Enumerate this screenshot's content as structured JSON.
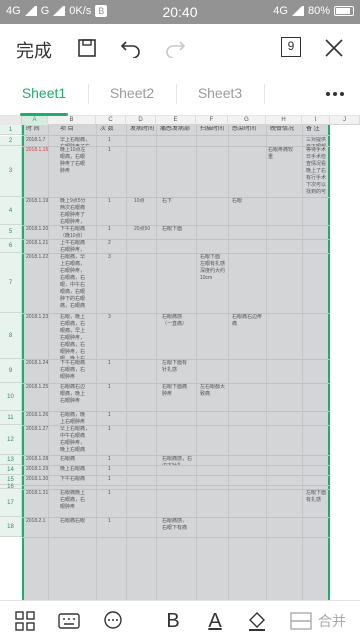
{
  "status": {
    "carrier1": "4G",
    "carrier2": "G",
    "speed": "0K/s",
    "b_badge": "B",
    "time": "20:40",
    "net": "4G",
    "battery": "80%"
  },
  "toolbar": {
    "done_label": "完成",
    "sheet_count": "9"
  },
  "tabs": [
    {
      "label": "Sheet1"
    },
    {
      "label": "Sheet2"
    },
    {
      "label": "Sheet3"
    }
  ],
  "columns": [
    "A",
    "B",
    "C",
    "D",
    "E",
    "F",
    "G",
    "H",
    "I",
    "J"
  ],
  "header_row": [
    "时 间",
    "项 目",
    "次 数",
    "发病时间",
    "痛感发病部",
    "扫描时间",
    "感染时间",
    "晚餐情况",
    "备 注"
  ],
  "rows": [
    {
      "num": "2",
      "date": "2018.1.7",
      "item": "早上右眼痛，\n右眼肿疼了右",
      "count": "1",
      "e": "",
      "f": "",
      "g": "",
      "h": "",
      "i": "",
      "j": "三对提供\n日下眼部\n疾病，\n医药公安"
    },
    {
      "num": "3",
      "date": "2018.1.15",
      "item": "晚上10点左\n眼痛，右眼\n肿疼了右眼\n肿疼",
      "count": "1",
      "e": "",
      "f": "",
      "g": "",
      "h": "",
      "i": "右眼疼痛较\n重",
      "j": "等待手术\n日手术检\n查情况看\n晚上了右\n有行手术\n下次可以\n找到的可"
    },
    {
      "num": "4",
      "date": "2018.1.19",
      "item": "晚上9点5分\n两次右眼痛\n右眼肿疼了\n右眼肿疼，\n右边晚间下",
      "count": "1",
      "e": "10点",
      "f": "右下",
      "g": "",
      "h": "右眼",
      "i": "",
      "j": ""
    },
    {
      "num": "5",
      "date": "2018.1.20",
      "item": "下午右眼痛\n（晚10点）",
      "count": "1",
      "e": "20点50",
      "f": "右眼下面",
      "g": "",
      "h": "",
      "i": "",
      "j": ""
    },
    {
      "num": "6",
      "date": "2018.1.21",
      "item": "上午右眼痛\n右眼肿疼，\n右眼肿疼",
      "count": "2",
      "e": "",
      "f": "",
      "g": "",
      "h": "",
      "i": "",
      "j": ""
    },
    {
      "num": "7",
      "date": "2018.1.22",
      "item": "右眼痛，早\n上右眼痛，\n右眼肿疼，\n右眼痛，右\n眼，中午右\n眼痛，右眼\n肿下的右眼\n痛，右眼痛",
      "count": "3",
      "e": "",
      "f": "",
      "g": "右眼下面\n左眼有扎感\n深度约大约\n10cm",
      "h": "",
      "i": "",
      "j": ""
    },
    {
      "num": "8",
      "date": "2018.1.23",
      "item": "右眼，晚上\n右眼痛，右\n眼痛，早上\n右眼肿疼，\n右眼痛，右\n眼肿疼，右\n眼，晚上右\n眼痛",
      "count": "3",
      "e": "",
      "f": "右眼痛感\n（一直痛）",
      "g": "",
      "h": "右眼痛右边疼\n痛",
      "i": "",
      "j": ""
    },
    {
      "num": "9",
      "date": "2018.1.24",
      "item": "下午右眼痛\n右眼痛，右\n眼肿疼",
      "count": "1",
      "e": "",
      "f": "左眼下面有\n针扎感",
      "g": "",
      "h": "",
      "i": "",
      "j": ""
    },
    {
      "num": "10",
      "date": "2018.1.25",
      "item": "右眼痛右边\n眼痛，晚上\n右眼肿疼",
      "count": "1",
      "e": "",
      "f": "右眼下面痛\n肿疼",
      "g": "左右眼都大\n致痛",
      "h": "",
      "i": "",
      "j": ""
    },
    {
      "num": "11",
      "date": "2018.1.26",
      "item": "右眼痛，晚\n上右眼肿疼\n右眼痛",
      "count": "1",
      "e": "",
      "f": "",
      "g": "",
      "h": "",
      "i": "",
      "j": ""
    },
    {
      "num": "12",
      "date": "2018.1.27",
      "item": "早上右眼痛，\n中午右眼痛\n右眼肿疼，\n晚上右眼痛",
      "count": "1",
      "e": "",
      "f": "",
      "g": "",
      "h": "",
      "i": "",
      "j": ""
    },
    {
      "num": "13",
      "date": "2018.1.28",
      "item": "右眼痛",
      "count": "1",
      "e": "",
      "f": "右眼痛感，右\n边下针扎",
      "g": "",
      "h": "",
      "i": "",
      "j": ""
    },
    {
      "num": "14",
      "date": "2018.1.29",
      "item": "晚上右眼痛",
      "count": "1",
      "e": "",
      "f": "",
      "g": "",
      "h": "",
      "i": "",
      "j": ""
    },
    {
      "num": "15",
      "date": "2018.1.30",
      "item": "下午右眼痛",
      "count": "1",
      "e": "",
      "f": "",
      "g": "",
      "h": "",
      "i": "",
      "j": ""
    },
    {
      "num": "16",
      "date": "",
      "item": "",
      "count": "",
      "e": "",
      "f": "",
      "g": "",
      "h": "",
      "i": "",
      "j": ""
    },
    {
      "num": "17",
      "date": "2018.1.31",
      "item": "右眼痛晚上\n右眼痛，右\n眼肿疼",
      "count": "1",
      "e": "",
      "f": "",
      "g": "",
      "h": "",
      "i": "",
      "j": "左眼下面\n有扎感"
    },
    {
      "num": "18",
      "date": "2018.2.1",
      "item": "右眼痛右眼",
      "count": "1",
      "e": "",
      "f": "右眼痛感，\n右眼下有痛",
      "g": "",
      "h": "",
      "i": "",
      "j": ""
    }
  ],
  "bottom": {
    "bold_label": "B",
    "font_color_label": "A",
    "merge_label": "合并"
  },
  "colors": {
    "accent": "#1fad6a",
    "statusbar": "#939393",
    "sheet_bg": "#d4d5d6",
    "highlight_date": "#d23a3a"
  }
}
